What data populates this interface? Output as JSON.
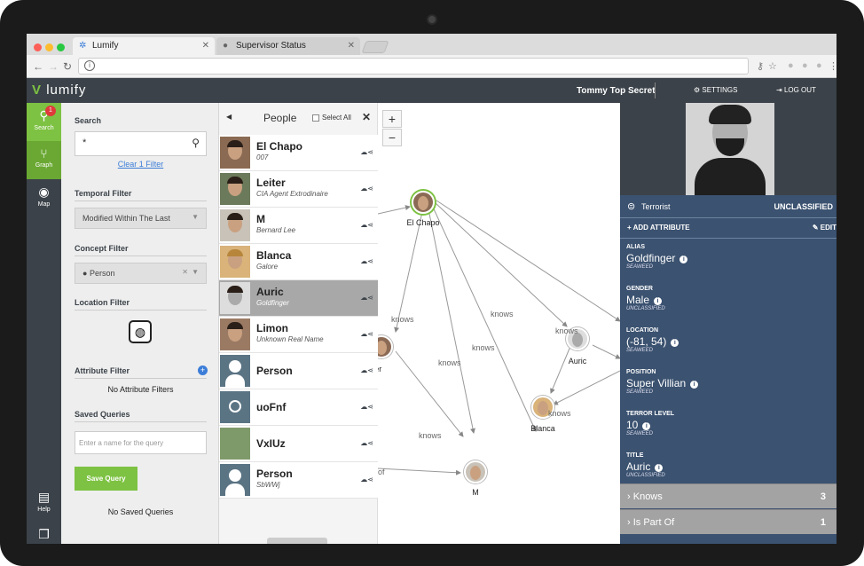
{
  "browser": {
    "tabs": [
      {
        "label": "Lumify"
      },
      {
        "label": "Supervisor Status"
      }
    ]
  },
  "app": {
    "logo": "lumify",
    "user": "Tommy Top Secret",
    "settings": "SETTINGS",
    "logout": "LOG OUT"
  },
  "nav": {
    "items": [
      {
        "label": "Search",
        "badge": "1"
      },
      {
        "label": "Graph"
      },
      {
        "label": "Map"
      },
      {
        "label": "Help"
      }
    ]
  },
  "search": {
    "title": "Search",
    "query": "*",
    "clear_filter": "Clear 1 Filter",
    "temporal_title": "Temporal Filter",
    "temporal_value": "Modified Within The Last",
    "concept_title": "Concept Filter",
    "concept_value": "Person",
    "location_title": "Location Filter",
    "attribute_title": "Attribute Filter",
    "no_attribute": "No Attribute Filters",
    "saved_title": "Saved Queries",
    "query_placeholder": "Enter a name for the query",
    "save_button": "Save Query",
    "no_saved": "No Saved Queries"
  },
  "people": {
    "title": "People",
    "select_all": "Select All",
    "rows": [
      {
        "name": "El Chapo",
        "sub": "007"
      },
      {
        "name": "Leiter",
        "sub": "CIA Agent Extrodinaire"
      },
      {
        "name": "M",
        "sub": "Bernard Lee"
      },
      {
        "name": "Blanca",
        "sub": "Galore"
      },
      {
        "name": "Auric",
        "sub": "Goldfinger"
      },
      {
        "name": "Limon",
        "sub": "Unknown Real Name"
      },
      {
        "name": "Person",
        "sub": ""
      },
      {
        "name": "uoFnf",
        "sub": ""
      },
      {
        "name": "VxIUz",
        "sub": ""
      },
      {
        "name": "Person",
        "sub": "SbWWj"
      }
    ]
  },
  "graph": {
    "zoom_in": "+",
    "zoom_out": "−",
    "nodes": [
      {
        "label": "El Chapo"
      },
      {
        "label": "Leiter"
      },
      {
        "label": "Auric"
      },
      {
        "label": "Blanca"
      },
      {
        "label": "M"
      }
    ],
    "edge_label": "knows",
    "edge_label_partial": "of"
  },
  "detail": {
    "concept": "Terrorist",
    "classification": "UNCLASSIFIED",
    "add_attribute": "ADD ATTRIBUTE",
    "edit": "EDIT",
    "properties": [
      {
        "label": "ALIAS",
        "value": "Goldfinger",
        "source": "SEAWEED"
      },
      {
        "label": "GENDER",
        "value": "Male",
        "source": "UNCLASSIFIED"
      },
      {
        "label": "LOCATION",
        "value": "(-81, 54)",
        "source": "SEAWEED"
      },
      {
        "label": "POSITION",
        "value": "Super Villian",
        "source": "SEAWEED"
      },
      {
        "label": "TERROR LEVEL",
        "value": "10",
        "source": "SEAWEED"
      },
      {
        "label": "TITLE",
        "value": "Auric",
        "source": "UNCLASSIFIED"
      }
    ],
    "relations": [
      {
        "label": "Knows",
        "count": "3"
      },
      {
        "label": "Is Part Of",
        "count": "1"
      }
    ]
  }
}
